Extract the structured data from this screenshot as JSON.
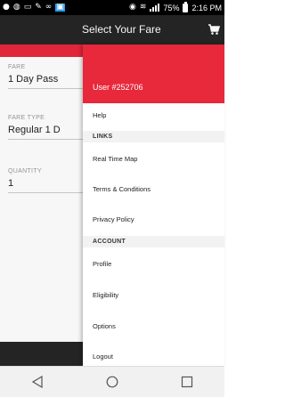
{
  "status_bar": {
    "battery": "75%",
    "time": "2:16 PM"
  },
  "header": {
    "title": "Select Your Fare"
  },
  "background_form": {
    "fields": [
      {
        "label": "FARE",
        "value": "1 Day Pass"
      },
      {
        "label": "FARE TYPE",
        "value": "Regular 1 D"
      },
      {
        "label": "QUANTITY",
        "value": "1"
      }
    ]
  },
  "drawer": {
    "user": "User #252706",
    "help": "Help",
    "links_header": "LINKS",
    "links": [
      "Real Time Map",
      "Terms & Conditions",
      "Privacy Policy"
    ],
    "account_header": "ACCOUNT",
    "account": [
      "Profile",
      "Eligibility",
      "Options",
      "Logout"
    ]
  },
  "colors": {
    "accent": "#e8283b",
    "header_bg": "#262626"
  }
}
